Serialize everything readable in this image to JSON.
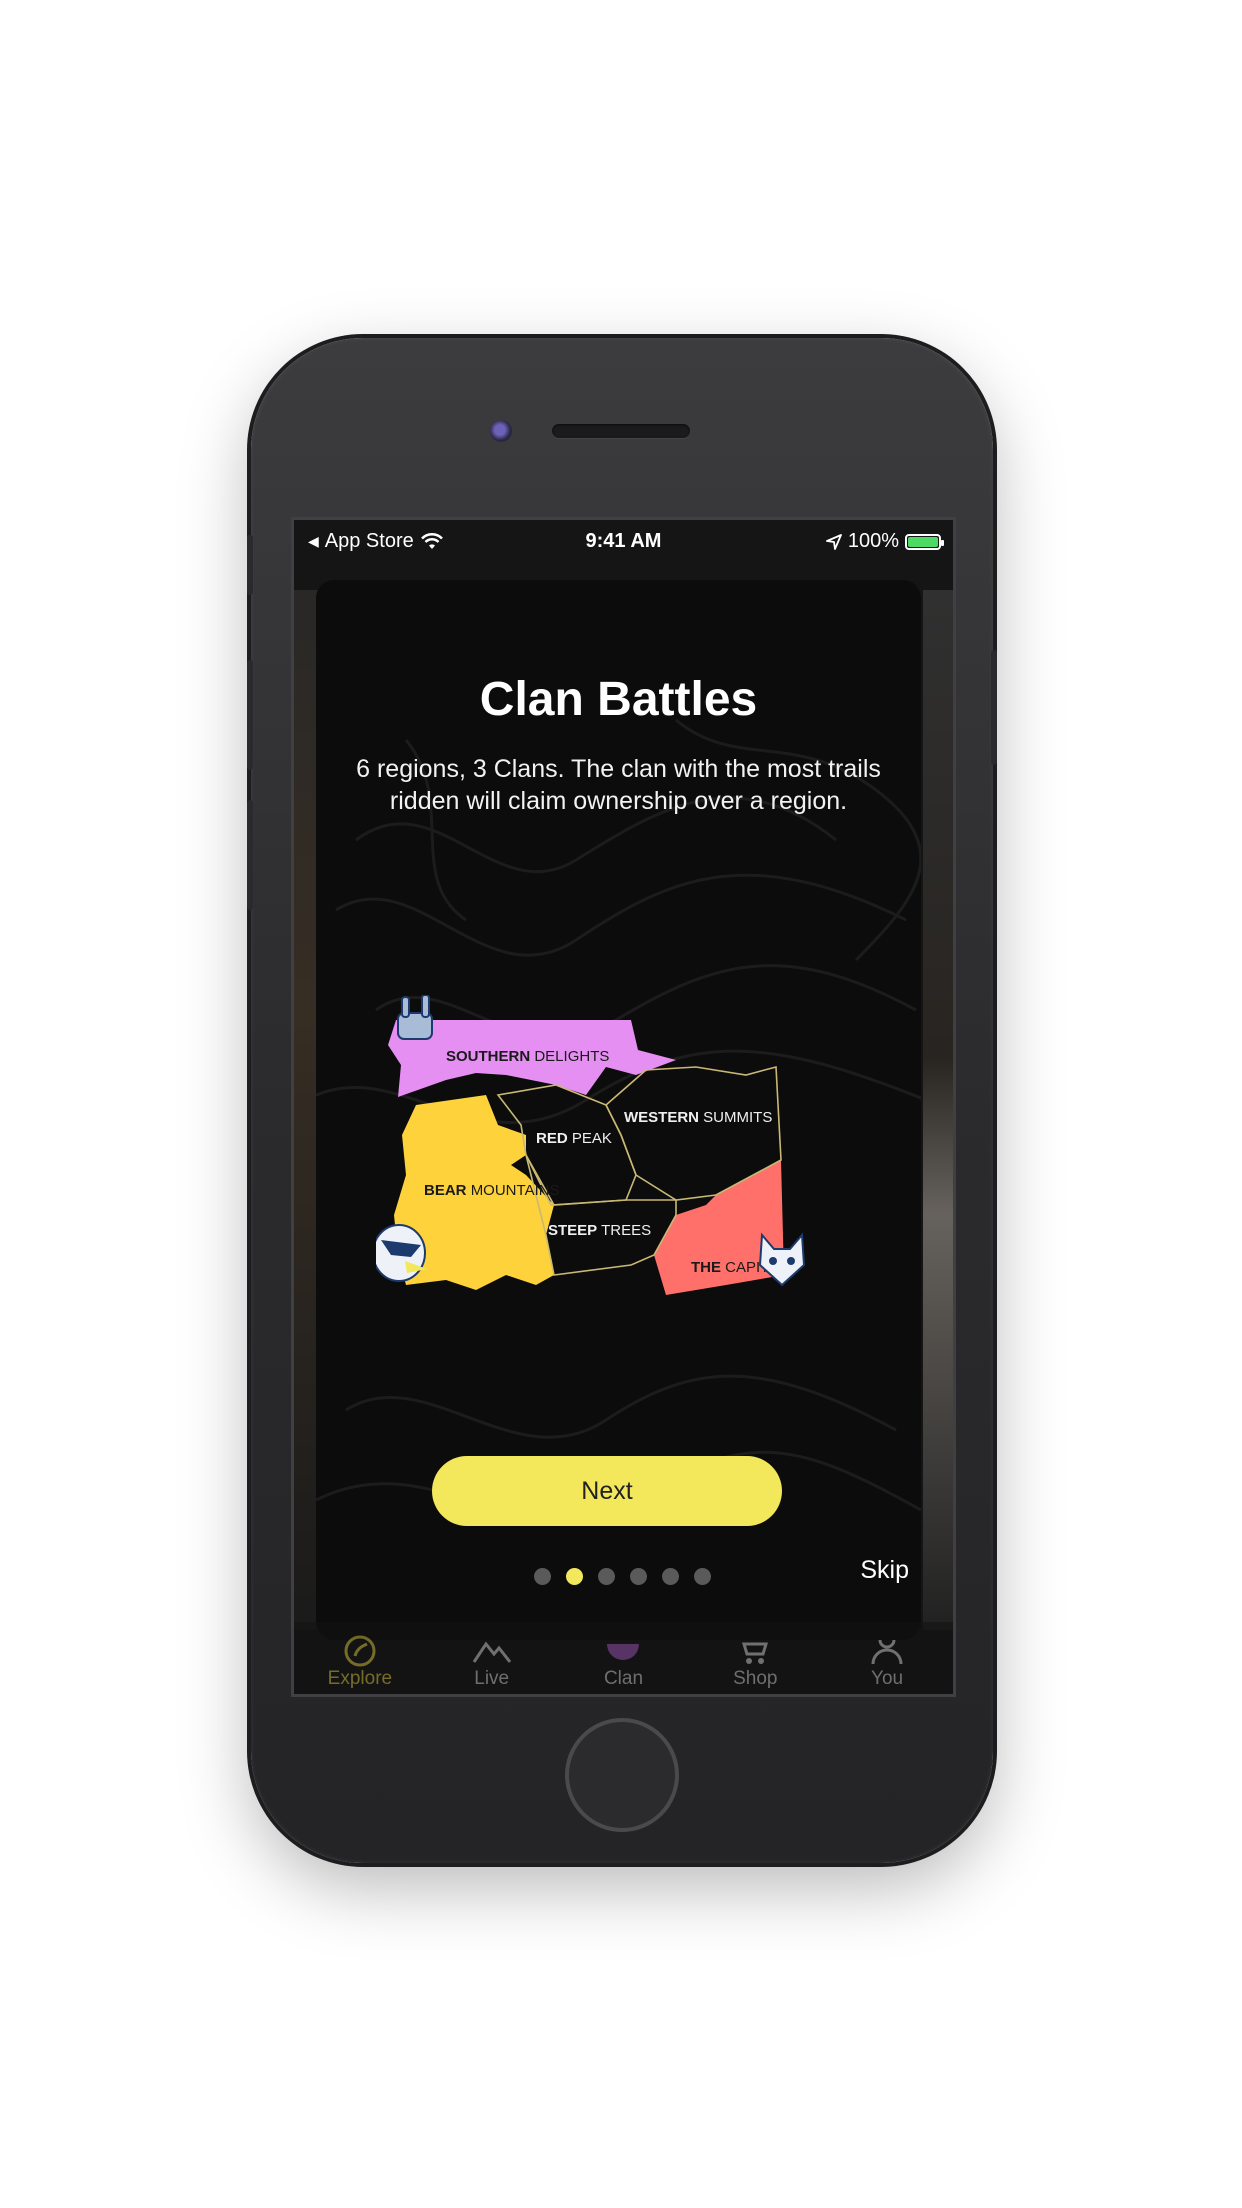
{
  "status_bar": {
    "back_app": "App Store",
    "time": "9:41 AM",
    "battery": "100%",
    "battery_level": 1.0
  },
  "onboarding": {
    "title": "Clan Battles",
    "description": "6 regions, 3 Clans. The clan with the most trails ridden will claim ownership over a region.",
    "next_label": "Next",
    "skip_label": "Skip",
    "page_count": 6,
    "current_page": 2
  },
  "map": {
    "regions": [
      {
        "bold": "SOUTHERN",
        "light": "DELIGHTS",
        "color": "#e58ff2"
      },
      {
        "bold": "RED",
        "light": "PEAK",
        "color": "#0c0c0c"
      },
      {
        "bold": "WESTERN",
        "light": "SUMMITS",
        "color": "#0c0c0c"
      },
      {
        "bold": "BEAR",
        "light": "MOUNTAINS",
        "color": "#fdd23b"
      },
      {
        "bold": "STEEP",
        "light": "TREES",
        "color": "#0c0c0c"
      },
      {
        "bold": "THE",
        "light": "CAPITAL",
        "color": "#ff706a"
      }
    ],
    "clan_icons": [
      "rock-hand-clan-icon",
      "eagle-clan-icon",
      "wolf-clan-icon"
    ]
  },
  "tab_bar": {
    "items": [
      {
        "label": "Explore",
        "icon": "explore-icon"
      },
      {
        "label": "Live",
        "icon": "mountain-icon"
      },
      {
        "label": "Clan",
        "icon": "clan-icon"
      },
      {
        "label": "Shop",
        "icon": "cart-icon"
      },
      {
        "label": "You",
        "icon": "person-icon"
      }
    ],
    "active_color": "#c6b43a"
  }
}
